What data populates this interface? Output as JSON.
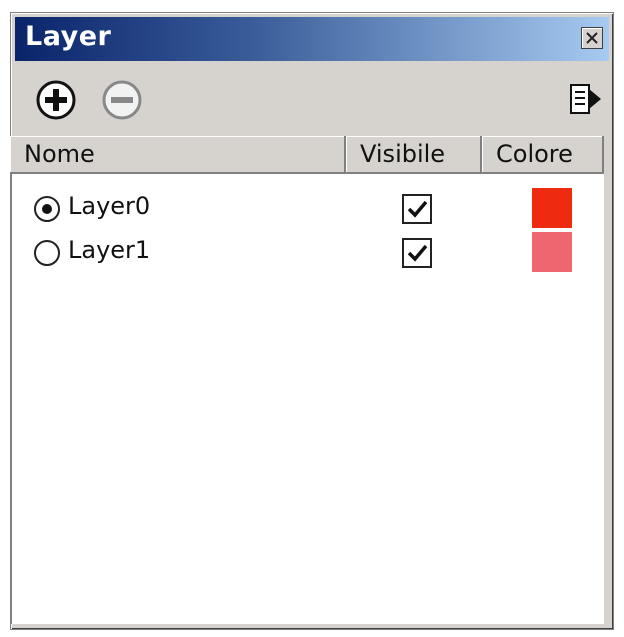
{
  "window": {
    "title": "Layer"
  },
  "toolbar": {
    "add_icon": "plus-circle-icon",
    "remove_icon": "minus-circle-icon",
    "details_icon": "arrow-page-icon"
  },
  "columns": [
    "Nome",
    "Visibile",
    "Colore"
  ],
  "layers": [
    {
      "name": "Layer0",
      "active": true,
      "visible": true,
      "color": "#ee2a10"
    },
    {
      "name": "Layer1",
      "active": false,
      "visible": true,
      "color": "#f06670"
    }
  ]
}
